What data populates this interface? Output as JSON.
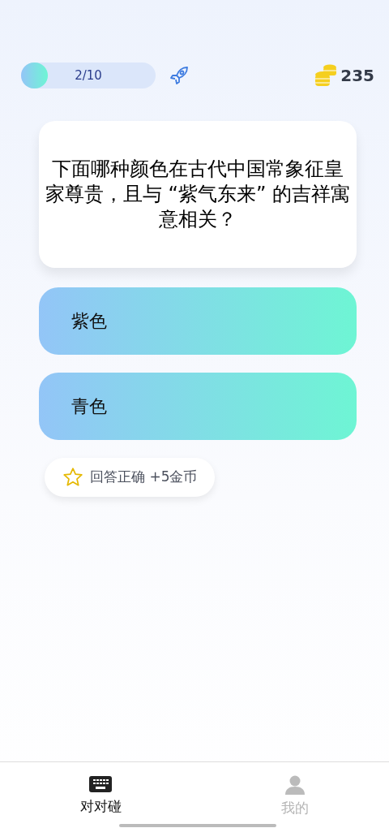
{
  "progress": {
    "label": "2/10",
    "level": 0.2
  },
  "coins": "235",
  "question": "下面哪种颜色在古代中国常象征皇家尊贵，且与 “紫气东来” 的吉祥寓意相关？",
  "options": [
    {
      "label": "紫色"
    },
    {
      "label": "青色"
    }
  ],
  "reward": "回答正确 +5金币",
  "tabs": [
    {
      "label": "对对碰",
      "kind": "keyboard",
      "selected": true
    },
    {
      "label": "我的",
      "kind": "person",
      "selected": false
    }
  ]
}
